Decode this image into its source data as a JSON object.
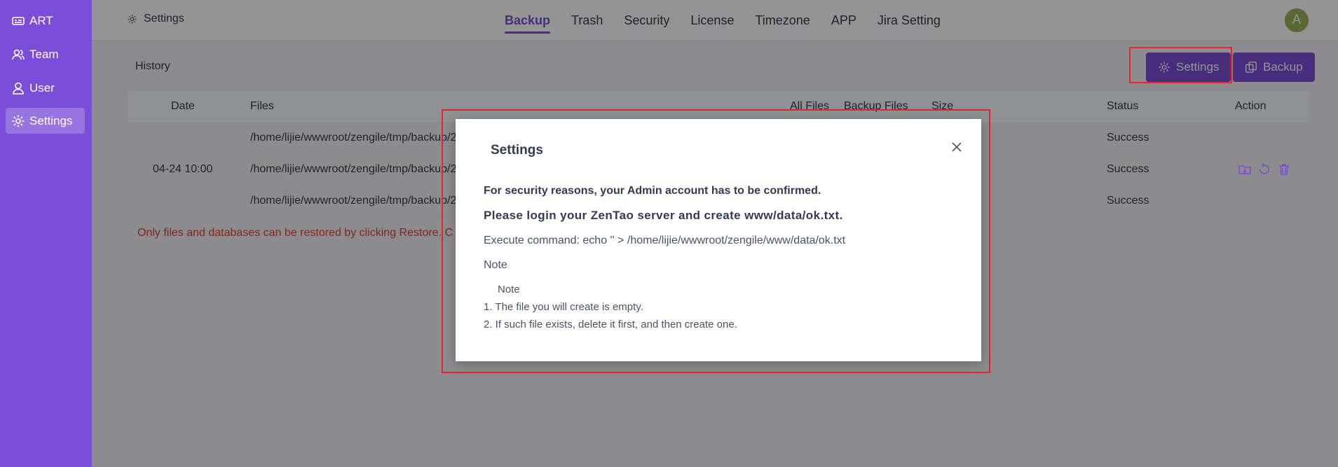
{
  "sidebar": {
    "items": [
      {
        "label": "ART",
        "icon": "art-logo-icon"
      },
      {
        "label": "Team",
        "icon": "team-icon"
      },
      {
        "label": "User",
        "icon": "user-icon"
      },
      {
        "label": "Settings",
        "icon": "gear-icon",
        "active": true
      }
    ],
    "bg_color": "#7c4dd8"
  },
  "header": {
    "breadcrumb": "Settings",
    "tabs": [
      "Backup",
      "Trash",
      "Security",
      "License",
      "Timezone",
      "APP",
      "Jira Setting"
    ],
    "active_tab": "Backup",
    "avatar_letter": "A"
  },
  "main": {
    "section_title": "History",
    "settings_button": "Settings",
    "backup_button": "Backup",
    "table": {
      "columns": [
        "Date",
        "Files",
        "All Files",
        "Backup Files",
        "Size",
        "Status",
        "Action"
      ],
      "date": "04-24 10:00",
      "rows": [
        {
          "file": "/home/lijie/wwwroot/zengile/tmp/backup/2",
          "status": "Success"
        },
        {
          "file": "/home/lijie/wwwroot/zengile/tmp/backup/2",
          "status": "Success"
        },
        {
          "file": "/home/lijie/wwwroot/zengile/tmp/backup/2",
          "status": "Success"
        }
      ],
      "note": "Only files and databases can be restored by clicking Restore. C"
    }
  },
  "modal": {
    "title": "Settings",
    "security_line": "For security reasons, your Admin account has to be confirmed.",
    "login_line": "Please login your ZenTao server and create www/data/ok.txt.",
    "command_line": "Execute command: echo '' > /home/lijie/wwwroot/zengile/www/data/ok.txt",
    "note_label": "Note",
    "note_heading": "Note",
    "note_items": [
      "1. The file you will create is empty.",
      "2. If such file exists, delete it first, and then create one."
    ]
  },
  "colors": {
    "accent": "#7c4dd8",
    "highlight": "#e5242b",
    "warning_text": "#e8412c"
  }
}
